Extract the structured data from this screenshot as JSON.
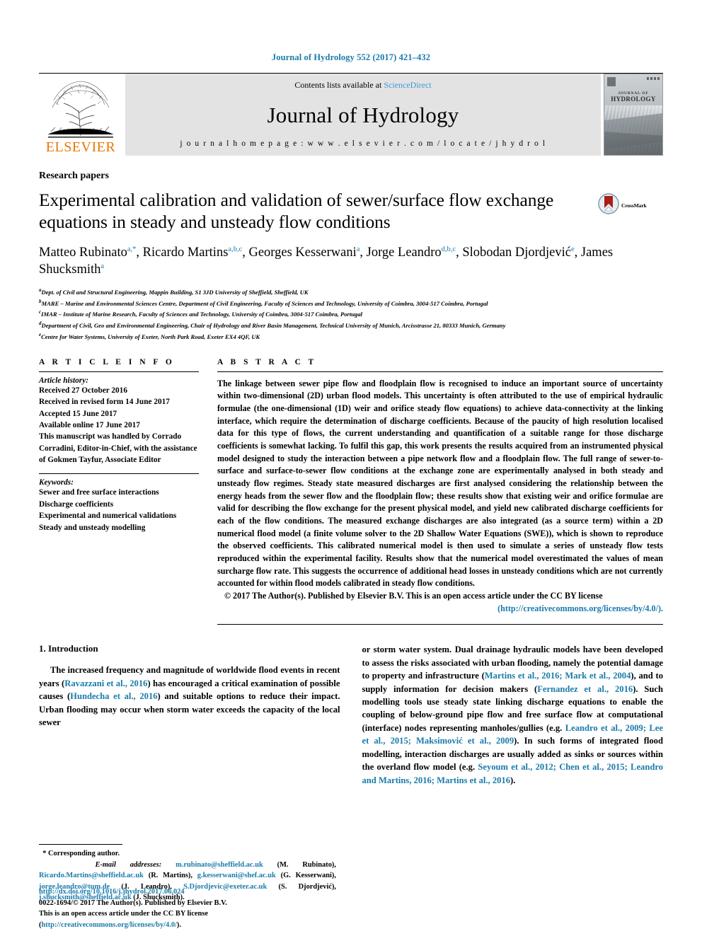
{
  "running_head": "Journal of Hydrology 552 (2017) 421–432",
  "banner": {
    "publisher_wordmark": "ELSEVIER",
    "contents_prefix": "Contents lists available at ",
    "contents_link": "ScienceDirect",
    "journal_title": "Journal of Hydrology",
    "homepage": "j o u r n a l   h o m e p a g e :   w w w . e l s e v i e r . c o m / l o c a t e / j h y d r o l",
    "cover_journal_small": "JOURNAL OF",
    "cover_journal_big": "HYDROLOGY"
  },
  "article": {
    "kicker": "Research papers",
    "title": "Experimental calibration and validation of sewer/surface flow exchange equations in steady and unsteady flow conditions",
    "crossmark_label": "CrossMark",
    "authors": [
      {
        "name": "Matteo Rubinato",
        "sup": "a,*",
        "sep": ", "
      },
      {
        "name": "Ricardo Martins",
        "sup": "a,b,c",
        "sep": ", "
      },
      {
        "name": "Georges Kesserwani",
        "sup": "a",
        "sep": ", "
      },
      {
        "name": "Jorge Leandro",
        "sup": "d,b,c",
        "sep": ", "
      },
      {
        "name": "Slobodan Djordjević",
        "sup": "e",
        "sep": ", "
      },
      {
        "name": "James Shucksmith",
        "sup": "a",
        "sep": ""
      }
    ],
    "affiliations": [
      {
        "mark": "a",
        "text": "Dept. of Civil and Structural Engineering, Mappin Building, S1 3JD University of Sheffield, Sheffield, UK"
      },
      {
        "mark": "b",
        "text": "MARE – Marine and Environmental Sciences Centre, Department of Civil Engineering, Faculty of Sciences and Technology, University of Coimbra, 3004-517 Coimbra, Portugal"
      },
      {
        "mark": "c",
        "text": "IMAR – Institute of Marine Research, Faculty of Sciences and Technology, University of Coimbra, 3004-517 Coimbra, Portugal"
      },
      {
        "mark": "d",
        "text": "Department of Civil, Geo and Environmental Engineering, Chair of Hydrology and River Basin Management, Technical University of Munich, Arcisstrasse 21, 80333 Munich, Germany"
      },
      {
        "mark": "e",
        "text": "Centre for Water Systems, University of Exeter, North Park Road, Exeter EX4 4QF, UK"
      }
    ]
  },
  "article_info": {
    "label": "A R T I C L E   I N F O",
    "history_title": "Article history:",
    "history": [
      "Received 27 October 2016",
      "Received in revised form 14 June 2017",
      "Accepted 15 June 2017",
      "Available online 17 June 2017",
      "This manuscript was handled by Corrado Corradini, Editor-in-Chief, with the assistance of Gokmen Tayfur, Associate Editor"
    ],
    "keywords_title": "Keywords:",
    "keywords": [
      "Sewer and free surface interactions",
      "Discharge coefficients",
      "Experimental and numerical validations",
      "Steady and unsteady modelling"
    ]
  },
  "abstract": {
    "label": "A B S T R A C T",
    "text": "The linkage between sewer pipe flow and floodplain flow is recognised to induce an important source of uncertainty within two-dimensional (2D) urban flood models. This uncertainty is often attributed to the use of empirical hydraulic formulae (the one-dimensional (1D) weir and orifice steady flow equations) to achieve data-connectivity at the linking interface, which require the determination of discharge coefficients. Because of the paucity of high resolution localised data for this type of flows, the current understanding and quantification of a suitable range for those discharge coefficients is somewhat lacking. To fulfil this gap, this work presents the results acquired from an instrumented physical model designed to study the interaction between a pipe network flow and a floodplain flow. The full range of sewer-to-surface and surface-to-sewer flow conditions at the exchange zone are experimentally analysed in both steady and unsteady flow regimes. Steady state measured discharges are first analysed considering the relationship between the energy heads from the sewer flow and the floodplain flow; these results show that existing weir and orifice formulae are valid for describing the flow exchange for the present physical model, and yield new calibrated discharge coefficients for each of the flow conditions. The measured exchange discharges are also integrated (as a source term) within a 2D numerical flood model (a finite volume solver to the 2D Shallow Water Equations (SWE)), which is shown to reproduce the observed coefficients. This calibrated numerical model is then used to simulate a series of unsteady flow tests reproduced within the experimental facility. Results show that the numerical model overestimated the values of mean surcharge flow rate. This suggests the occurrence of additional head losses in unsteady conditions which are not currently accounted for within flood models calibrated in steady flow conditions.",
    "copyright": "© 2017 The Author(s). Published by Elsevier B.V. This is an open access article under the CC BY license",
    "license_url": "(http://creativecommons.org/licenses/by/4.0/)."
  },
  "introduction": {
    "heading": "1. Introduction",
    "left_paragraph_pre": "The increased frequency and magnitude of worldwide flood events in recent years (",
    "left_cite_1": "Ravazzani et al., 2016",
    "left_mid_1": ") has encouraged a critical examination of possible causes (",
    "left_cite_2": "Hundecha et al., 2016",
    "left_tail": ") and suitable options to reduce their impact. Urban flooding may occur when storm water exceeds the capacity of the local sewer",
    "right_pre": "or storm water system. Dual drainage hydraulic models have been developed to assess the risks associated with urban flooding, namely the potential damage to property and infrastructure (",
    "right_cite_1": "Martins et al., 2016; Mark et al., 2004",
    "right_mid_1": "), and to supply information for decision makers (",
    "right_cite_2": "Fernandez et al., 2016",
    "right_mid_2": "). Such modelling tools use steady state linking discharge equations to enable the coupling of below-ground pipe flow and free surface flow at computational (interface) nodes representing manholes/gullies (e.g. ",
    "right_cite_3": "Leandro et al., 2009; Lee et al., 2015; Maksimović et al., 2009",
    "right_mid_3": "). In such forms of integrated flood modelling, interaction discharges are usually added as sinks or sources within the overland flow model (e.g. ",
    "right_cite_4": "Seyoum et al., 2012; Chen et al., 2015; Leandro and Martins, 2016; Martins et al., 2016",
    "right_tail": ")."
  },
  "footnotes": {
    "corresponding": "* Corresponding author.",
    "email_label": "E-mail addresses:",
    "emails": [
      {
        "addr": "m.rubinato@sheffield.ac.uk",
        "who": " (M. Rubinato), "
      },
      {
        "addr": "Ricardo.Martins@sheffield.ac.uk",
        "who": " (R. Martins), "
      },
      {
        "addr": "g.kesserwani@shef.ac.uk",
        "who": " (G. Kesserwani), "
      },
      {
        "addr": "jorge.leandro@tum.de",
        "who": " (J. Leandro), "
      },
      {
        "addr": "S.Djordjevic@exeter.ac.uk",
        "who": " (S. Djordjević), "
      },
      {
        "addr": "j.shucksmith@sheffield.ac.uk",
        "who": " (J. Shucksmith)."
      }
    ]
  },
  "doi_block": {
    "doi": "http://dx.doi.org/10.1016/j.jhydrol.2017.06.024",
    "issn_line": "0022-1694/© 2017 The Author(s). Published by Elsevier B.V.",
    "license_pre": "This is an open access article under the CC BY license (",
    "license_link": "http://creativecommons.org/licenses/by/4.0/",
    "license_post": ")."
  },
  "colors": {
    "link": "#1a7bab",
    "elsevier_orange": "#ea7600",
    "banner_grey": "#e3e3e3"
  }
}
